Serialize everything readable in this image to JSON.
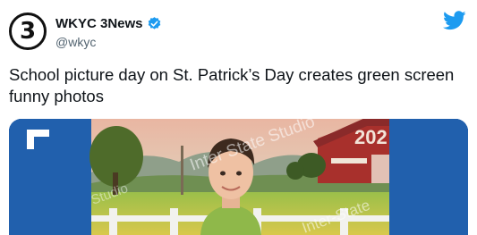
{
  "account": {
    "display_name": "WKYC 3News",
    "handle": "@wkyc",
    "avatar_text": "3",
    "verified_icon": "verified-badge-icon",
    "verified_color": "#1d9bf0"
  },
  "platform_icon": "twitter-bird-icon",
  "brand_color": "#1d9bf0",
  "tweet": {
    "text": "School picture day on St. Patrick’s Day creates green screen funny photos"
  },
  "media": {
    "watermark_1": "Inter State Studio",
    "watermark_2": "Inter-State",
    "watermark_3": "Studio",
    "barn_year": "202"
  }
}
